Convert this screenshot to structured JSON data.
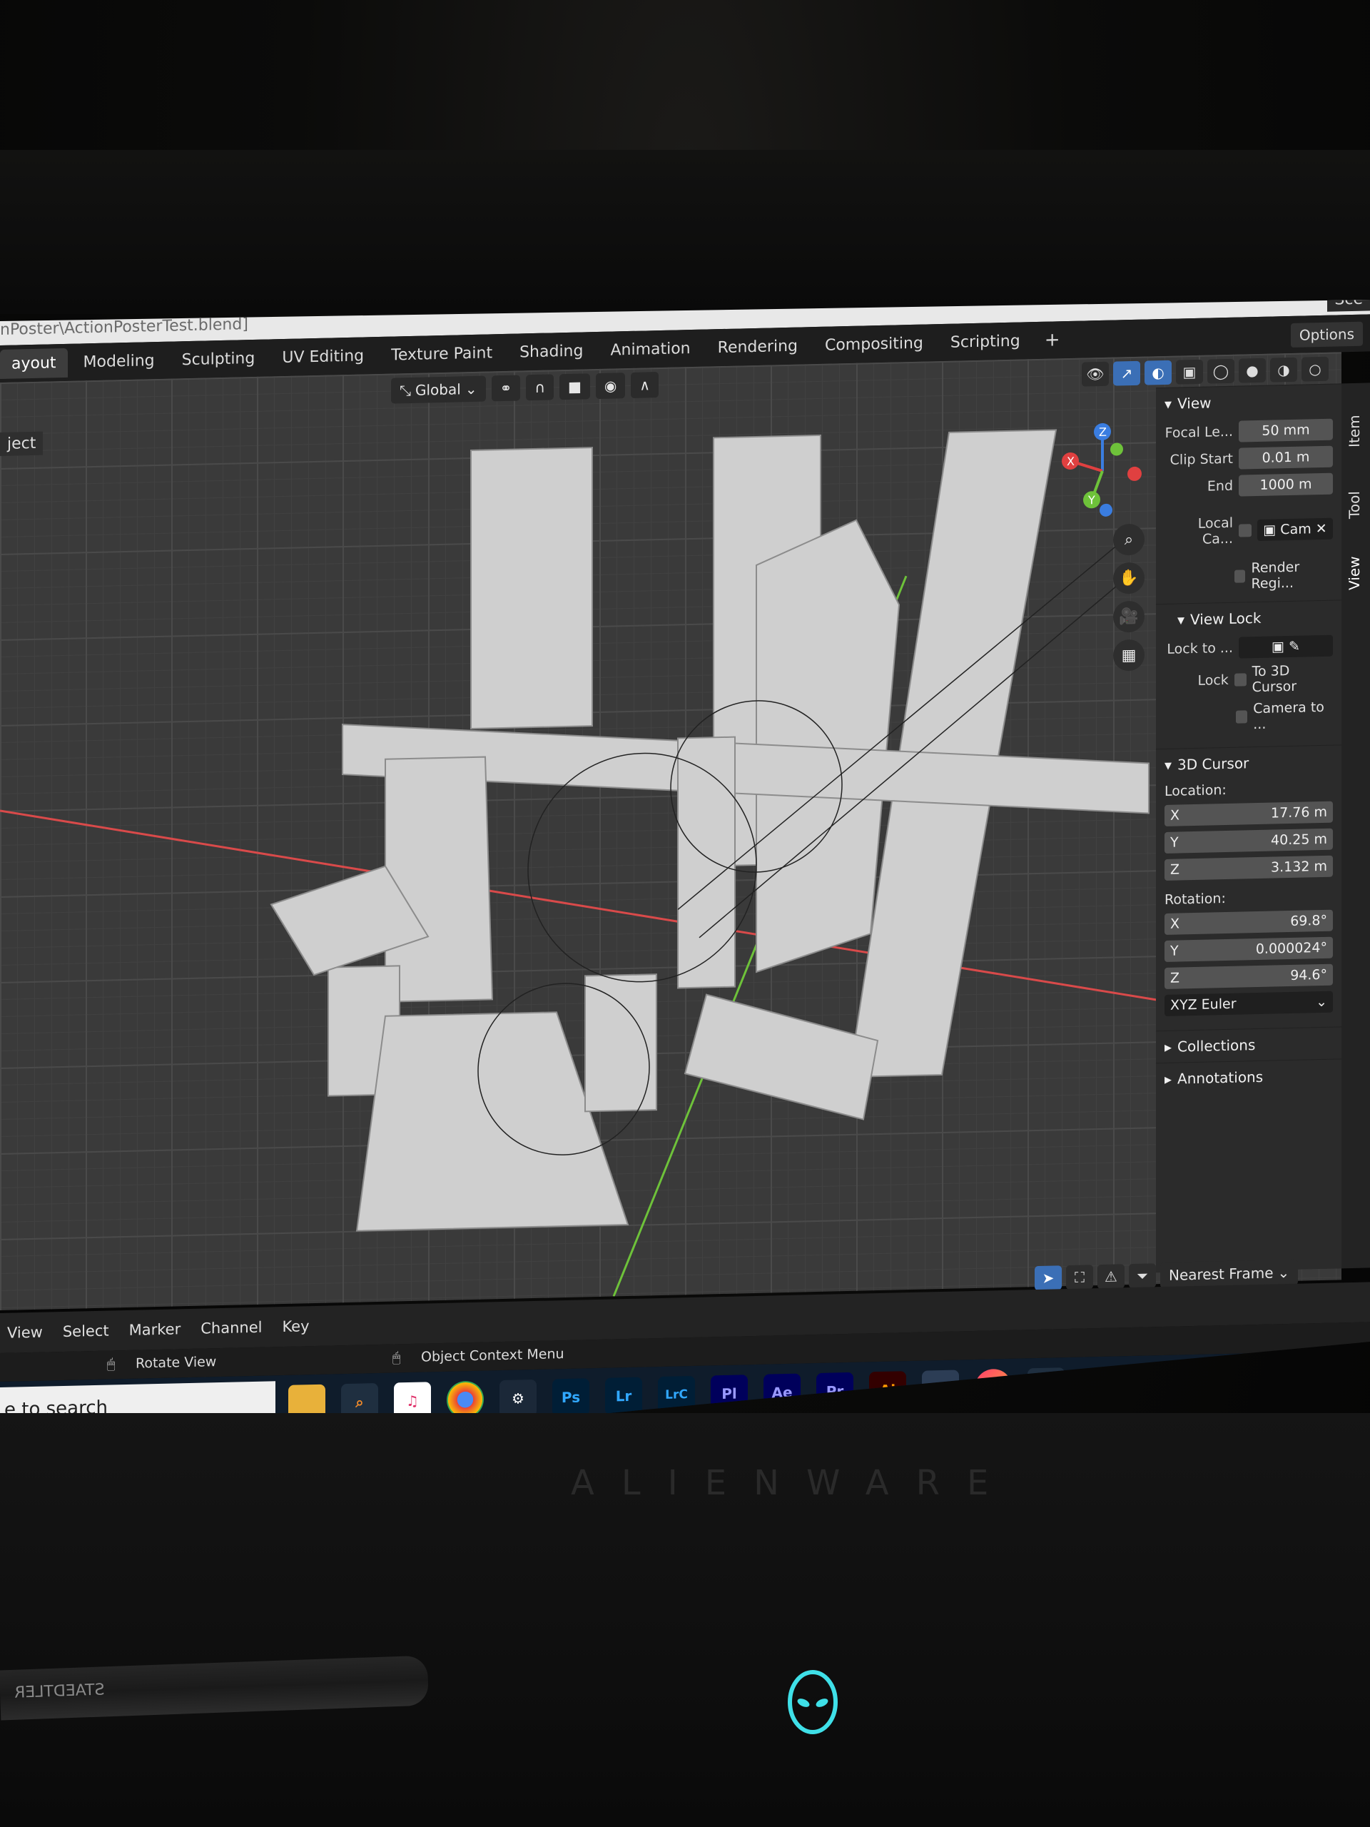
{
  "window": {
    "file_path": "nPoster\\ActionPosterTest.blend]",
    "scene_label": "Sce"
  },
  "workspace_tabs": [
    {
      "label": "ayout",
      "active": true
    },
    {
      "label": "Modeling"
    },
    {
      "label": "Sculpting"
    },
    {
      "label": "UV Editing"
    },
    {
      "label": "Texture Paint"
    },
    {
      "label": "Shading"
    },
    {
      "label": "Animation"
    },
    {
      "label": "Rendering"
    },
    {
      "label": "Compositing"
    },
    {
      "label": "Scripting"
    }
  ],
  "add_workspace": "+",
  "options_label": "Options",
  "viewport": {
    "mode_fragment": "ject",
    "transform_orientation": "Global",
    "snap_target": "Nearest Frame",
    "gizmo_axes": {
      "x": "X",
      "y": "Y",
      "z": "Z"
    }
  },
  "side_tabs": [
    "Item",
    "Tool",
    "View"
  ],
  "npanel": {
    "view": {
      "title": "View",
      "focal_length_label": "Focal Le...",
      "focal_length": "50 mm",
      "clip_start_label": "Clip Start",
      "clip_start": "0.01 m",
      "end_label": "End",
      "end": "1000 m",
      "local_camera_label": "Local Ca...",
      "camera_value": "Cam",
      "render_region_label": "Render Regi..."
    },
    "view_lock": {
      "title": "View Lock",
      "lock_to_label": "Lock to ...",
      "lock_label": "Lock",
      "to_3d_cursor": "To 3D Cursor",
      "camera_to": "Camera to ..."
    },
    "cursor": {
      "title": "3D Cursor",
      "location_label": "Location:",
      "loc_x_label": "X",
      "loc_x": "17.76 m",
      "loc_y_label": "Y",
      "loc_y": "40.25 m",
      "loc_z_label": "Z",
      "loc_z": "3.132 m",
      "rotation_label": "Rotation:",
      "rot_x_label": "X",
      "rot_x": "69.8°",
      "rot_y_label": "Y",
      "rot_y": "0.000024°",
      "rot_z_label": "Z",
      "rot_z": "94.6°",
      "rotation_mode": "XYZ Euler"
    },
    "collections": "Collections",
    "annotations": "Annotations"
  },
  "timeline_menu": [
    "View",
    "Select",
    "Marker",
    "Channel",
    "Key"
  ],
  "status_bar": {
    "left_hint": "Rotate View",
    "right_hint": "Object Context Menu"
  },
  "taskbar": {
    "search_placeholder": "e to search",
    "apps": [
      {
        "name": "file-explorer",
        "label": ""
      },
      {
        "name": "search-app",
        "label": ""
      },
      {
        "name": "itunes",
        "label": "♫"
      },
      {
        "name": "chrome",
        "label": ""
      },
      {
        "name": "steam",
        "label": ""
      },
      {
        "name": "photoshop",
        "label": "Ps"
      },
      {
        "name": "lightroom",
        "label": "Lr"
      },
      {
        "name": "lightroom-classic",
        "label": "LrC"
      },
      {
        "name": "prelude",
        "label": "Pl"
      },
      {
        "name": "after-effects",
        "label": "Ae"
      },
      {
        "name": "premiere",
        "label": "Pr"
      },
      {
        "name": "illustrator",
        "label": "Ai"
      },
      {
        "name": "blender",
        "label": ""
      },
      {
        "name": "creative-cloud",
        "label": ""
      },
      {
        "name": "network-drive",
        "label": ""
      }
    ]
  },
  "hardware": {
    "brand": "ALIENWARE",
    "pen_text": "STAEDTLER"
  },
  "colors": {
    "blender_dark": "#2b2b2b",
    "active_blue": "#3b6fb6",
    "axis_x": "#e04040",
    "axis_y": "#6ec23a",
    "axis_z": "#3a7de0",
    "taskbar_bg": "#0f1c2b",
    "alien_glow": "#3fe0e8"
  }
}
